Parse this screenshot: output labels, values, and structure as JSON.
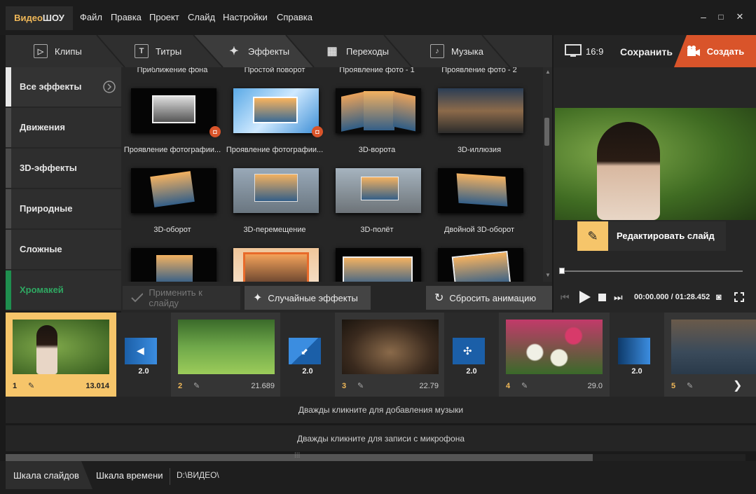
{
  "app": {
    "logo_a": "Видео",
    "logo_b": "ШОУ"
  },
  "menu": [
    "Файл",
    "Правка",
    "Проект",
    "Слайд",
    "Настройки",
    "Справка"
  ],
  "window": {
    "minimize": "–",
    "maximize": "□",
    "close": "✕"
  },
  "tabs": [
    {
      "label": "Клипы",
      "icon": "▷"
    },
    {
      "label": "Титры",
      "icon": "T"
    },
    {
      "label": "Эффекты",
      "icon": "✦"
    },
    {
      "label": "Переходы",
      "icon": "▦"
    },
    {
      "label": "Музыка",
      "icon": "♪"
    }
  ],
  "toolbar": {
    "ratio": "16:9",
    "save": "Сохранить",
    "create": "Создать"
  },
  "categories": [
    "Все эффекты",
    "Движения",
    "3D-эффекты",
    "Природные",
    "Сложные",
    "Хромакей"
  ],
  "effects_row0": [
    "Приближение фона",
    "Простой поворот",
    "Проявление фото - 1",
    "Проявление фото - 2"
  ],
  "effects_row1": [
    "Проявление фотографии...",
    "Проявление фотографии...",
    "3D-ворота",
    "3D-иллюзия"
  ],
  "effects_row2": [
    "3D-оборот",
    "3D-перемещение",
    "3D-полёт",
    "Двойной 3D-оборот"
  ],
  "buttons": {
    "apply": "Применить к слайду",
    "random": "Случайные эффекты",
    "reset": "Сбросить анимацию"
  },
  "preview": {
    "edit": "Редактировать слайд",
    "time_current": "00:00.000",
    "time_sep": " / ",
    "time_total": "01:28.452",
    "progress": 0
  },
  "slides": [
    {
      "num": "1",
      "dur": "13.014"
    },
    {
      "num": "2",
      "dur": "21.689"
    },
    {
      "num": "3",
      "dur": "22.79"
    },
    {
      "num": "4",
      "dur": "29.0"
    },
    {
      "num": "5",
      "dur": ""
    }
  ],
  "transitions": [
    "2.0",
    "2.0",
    "2.0",
    "2.0"
  ],
  "lanes": {
    "music": "Дважды кликните для добавления музыки",
    "mic": "Дважды кликните для записи с микрофона"
  },
  "bottom": {
    "slides_view": "Шкала слайдов",
    "time_view": "Шкала времени",
    "path": "D:\\ВИДЕО\\"
  },
  "colors": {
    "accent": "#d9542a",
    "highlight": "#f6c56a",
    "chroma": "#1f8f4f"
  }
}
